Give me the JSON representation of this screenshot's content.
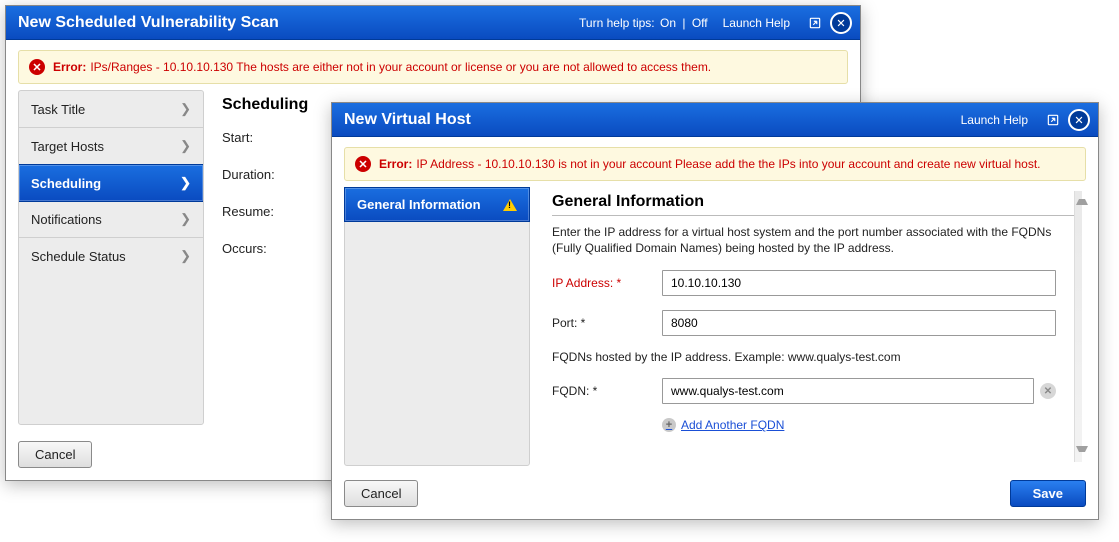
{
  "back": {
    "title": "New Scheduled Vulnerability Scan",
    "helptips_label": "Turn help tips:",
    "helptips_on": "On",
    "helptips_off": "Off",
    "launch_help": "Launch Help",
    "error_label": "Error:",
    "error_msg": "IPs/Ranges - 10.10.10.130 The hosts are either not in your account or license or you are not allowed to access them.",
    "nav": {
      "items": [
        {
          "label": "Task Title"
        },
        {
          "label": "Target Hosts"
        },
        {
          "label": "Scheduling"
        },
        {
          "label": "Notifications"
        },
        {
          "label": "Schedule Status"
        }
      ],
      "active_index": 2
    },
    "section_title": "Scheduling",
    "fields": {
      "start": "Start:",
      "duration": "Duration:",
      "resume": "Resume:",
      "occurs": "Occurs:"
    },
    "cancel": "Cancel"
  },
  "front": {
    "title": "New Virtual Host",
    "launch_help": "Launch Help",
    "error_label": "Error:",
    "error_msg": "IP Address - 10.10.10.130 is not in your account Please add the the IPs into your account and create new virtual host.",
    "tab_label": "General Information",
    "section_title": "General Information",
    "description": "Enter the IP address for a virtual host system and the port number associated with the FQDNs (Fully Qualified Domain Names) being hosted by the IP address.",
    "ip_label": "IP Address: *",
    "ip_value": "10.10.10.130",
    "port_label": "Port: *",
    "port_value": "8080",
    "fqdn_note": "FQDNs hosted by the IP address. Example: www.qualys-test.com",
    "fqdn_label": "FQDN: *",
    "fqdn_value": "www.qualys-test.com",
    "add_fqdn": "Add Another FQDN",
    "cancel": "Cancel",
    "save": "Save"
  }
}
